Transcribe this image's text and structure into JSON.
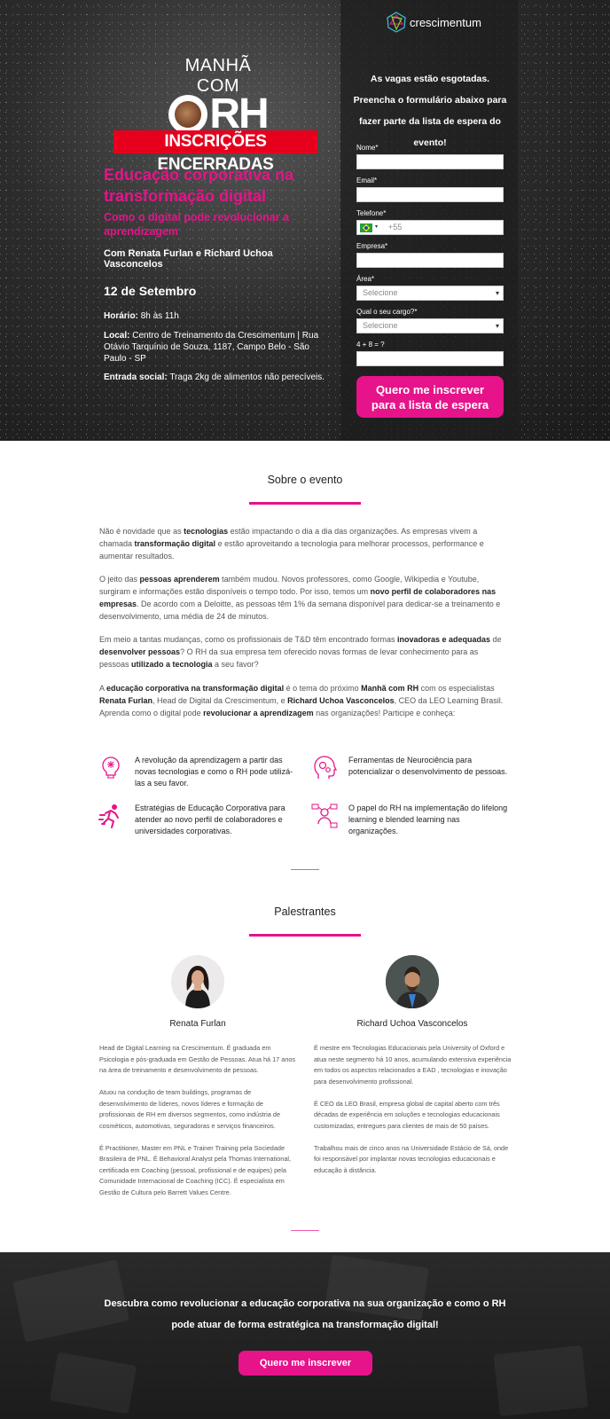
{
  "hero": {
    "logo_line1": "MANHÃ COM",
    "logo_line2": "RH",
    "closed_badge": "INSCRIÇÕES ENCERRADAS",
    "title": "Educação corporativa na transformação digital",
    "subtitle": "Como o digital pode revolucionar a aprendizagem",
    "speakers": "Com Renata Furlan e Richard Uchoa Vasconcelos",
    "date": "12 de Setembro",
    "time_label": "Horário:",
    "time_value": "8h às 11h",
    "local_label": "Local:",
    "local_value": "Centro de Treinamento da Crescimentum | Rua Otávio Tarquínio de Souza, 1187, Campo Belo - São Paulo - SP",
    "social_label": "Entrada social:",
    "social_value": "Traga 2kg de alimentos não perecíveis."
  },
  "form": {
    "brand": "crescimentum",
    "intro": "As vagas estão esgotadas. Preencha o formulário abaixo para fazer parte da lista de espera do evento!",
    "name_label": "Nome*",
    "email_label": "Email*",
    "phone_label": "Telefone*",
    "phone_prefix": "+55",
    "company_label": "Empresa*",
    "area_label": "Área*",
    "area_value": "Selecione",
    "role_label": "Qual o seu cargo?*",
    "role_value": "Selecione",
    "captcha_label": "4 + 8 = ?",
    "submit": "Quero me inscrever para a lista de espera"
  },
  "about": {
    "title": "Sobre o evento",
    "p1": [
      {
        "t": "Não é novidade que as "
      },
      {
        "t": "tecnologias",
        "b": true
      },
      {
        "t": " estão impactando o dia a dia das organizações. As empresas vivem a chamada "
      },
      {
        "t": "transformação digital",
        "b": true
      },
      {
        "t": " e estão aproveitando a tecnologia para melhorar processos, performance e aumentar resultados."
      }
    ],
    "p2": [
      {
        "t": "O jeito das "
      },
      {
        "t": "pessoas aprenderem",
        "b": true
      },
      {
        "t": " também mudou. Novos professores, como Google, Wikipedia e Youtube, surgiram e informações estão disponíveis o tempo todo. Por isso, temos um "
      },
      {
        "t": "novo perfil de colaboradores nas empresas",
        "b": true
      },
      {
        "t": ". De acordo com a Deloitte, as pessoas têm 1% da semana disponível para dedicar-se a treinamento e desenvolvimento, uma média de 24 de minutos."
      }
    ],
    "p3": [
      {
        "t": "Em meio a tantas mudanças, como os profissionais de T&D têm encontrado formas "
      },
      {
        "t": "inovadoras e adequadas",
        "b": true
      },
      {
        "t": " de "
      },
      {
        "t": "desenvolver pessoas",
        "b": true
      },
      {
        "t": "? O RH da sua empresa tem oferecido novas formas de levar conhecimento para as pessoas "
      },
      {
        "t": "utilizado a tecnologia",
        "b": true
      },
      {
        "t": " a seu favor?"
      }
    ],
    "p4": [
      {
        "t": "A "
      },
      {
        "t": "educação corporativa na transformação digital",
        "b": true
      },
      {
        "t": " é o tema do próximo "
      },
      {
        "t": "Manhã com RH",
        "b": true
      },
      {
        "t": " com os especialistas "
      },
      {
        "t": "Renata Furlan",
        "b": true
      },
      {
        "t": ", Head de Digital da Crescimentum, e "
      },
      {
        "t": "Richard Uchoa Vasconcelos",
        "b": true
      },
      {
        "t": ", CEO da LEO Learning Brasil. Aprenda como o digital pode "
      },
      {
        "t": "revolucionar a aprendizagem",
        "b": true
      },
      {
        "t": " nas organizações! Participe e conheça:"
      }
    ],
    "features": [
      {
        "icon": "brain-lightbulb-icon",
        "text": "A revolução da aprendizagem a partir das novas tecnologias e como o RH pode utilizá-las a seu favor."
      },
      {
        "icon": "head-gears-icon",
        "text": "Ferramentas de Neurociência para potencializar o desenvolvimento de pessoas."
      },
      {
        "icon": "running-person-icon",
        "text": "Estratégias de Educação Corporativa para atender ao novo perfil de colaboradores e universidades corporativas."
      },
      {
        "icon": "person-network-icon",
        "text": "O papel do RH na implementação do lifelong learning e blended learning nas organizações."
      }
    ]
  },
  "speakers_section": {
    "title": "Palestrantes",
    "speakers": [
      {
        "name": "Renata Furlan",
        "bio": [
          "Head de Digital Learning na Crescimentum. É graduada em Psicologia e pós-graduada em Gestão de Pessoas. Atua há 17 anos na área de treinamento e desenvolvimento de pessoas.",
          "Atuou na condução de team buildings, programas de desenvolvimento de líderes, novos líderes e formação de profissionais de RH em diversos segmentos, como indústria de cosméticos, automotivas, seguradoras e serviços financeiros.",
          "É Practitioner, Master em PNL e Trainer Training pela Sociedade Brasileira de PNL. É Behavioral Analyst pela Thomas International, certificada em Coaching (pessoal, profissional e de equipes) pela Comunidade Internacional de Coaching (ICC). É especialista em Gestão de Cultura pelo Barrett Values Centre."
        ]
      },
      {
        "name": "Richard Uchoa Vasconcelos",
        "bio": [
          "É mestre em Tecnologias Educacionais pela University of Oxford e atua neste segmento há 10 anos, acumulando extensiva experiência em todos os aspectos relacionados a EAD , tecnologias e inovação para desenvolvimento profissional.",
          "É CEO da LEO Brasil, empresa global de capital aberto com três décadas de experiência em soluções e tecnologias educacionais customizadas, entregues para clientes de mais de 50 países.",
          "Trabalhou mais de cinco anos na Universidade Estácio de Sá, onde foi responsável por implantar novas tecnologias educacionais e educação à distância."
        ]
      }
    ]
  },
  "cta": {
    "text": "Descubra como revolucionar a educação corporativa na sua organização e como o RH pode atuar de forma estratégica na transformação digital!",
    "button": "Quero me inscrever"
  },
  "colors": {
    "accent": "#e6138a",
    "badge": "#e6001e",
    "dark": "#2a2a2a"
  }
}
